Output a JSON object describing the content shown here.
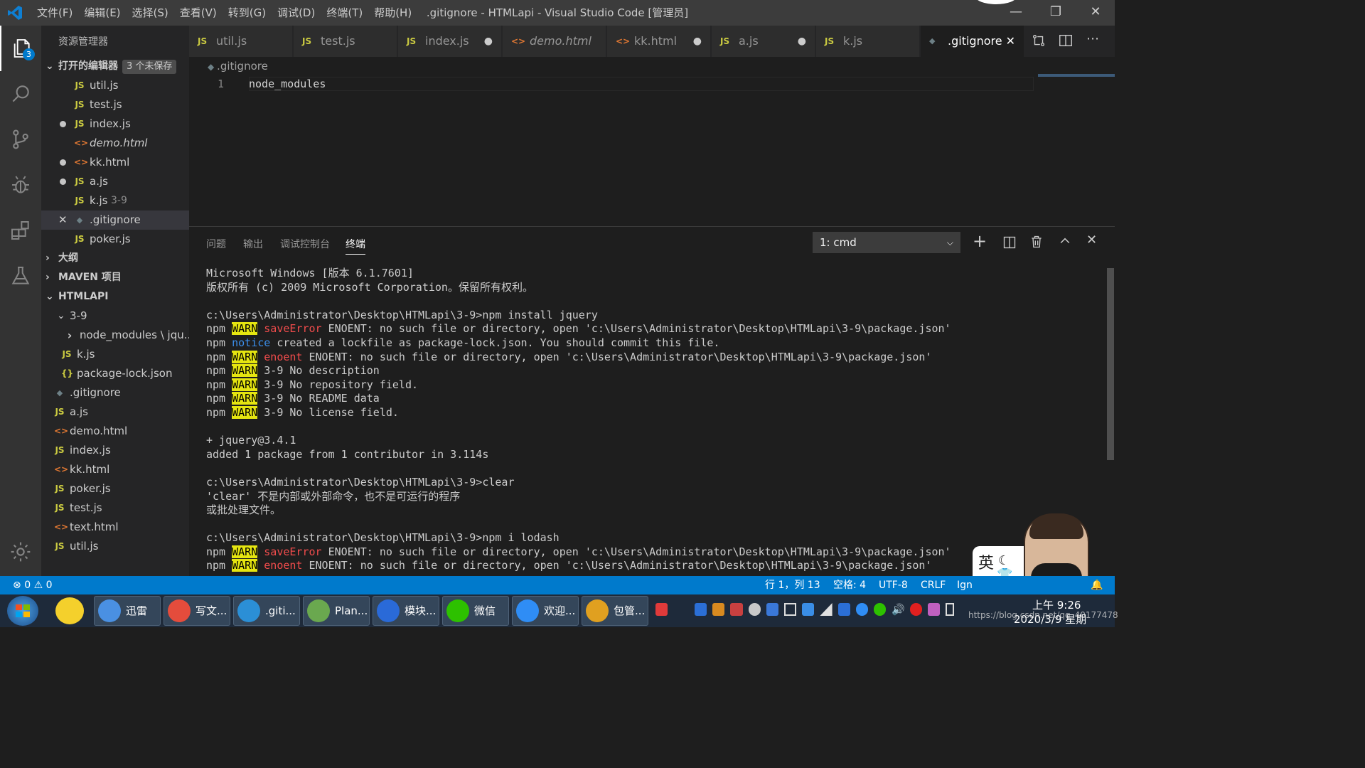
{
  "app": {
    "menu": [
      "文件(F)",
      "编辑(E)",
      "选择(S)",
      "查看(V)",
      "转到(G)",
      "调试(D)",
      "终端(T)",
      "帮助(H)"
    ],
    "window_title": ".gitignore - HTMLapi - Visual Studio Code [管理员]",
    "window_buttons": {
      "minimize": "—",
      "maximize": "❐",
      "close": "✕"
    }
  },
  "activity": {
    "explorer_badge": "3",
    "icons": [
      "files-icon",
      "search-icon",
      "source-control-icon",
      "debug-icon",
      "extensions-icon",
      "test-flask-icon",
      "settings-gear-icon"
    ]
  },
  "sidebar": {
    "title": "资源管理器",
    "open_editors": {
      "label": "打开的编辑器",
      "badge": "3 个未保存"
    },
    "open_files": [
      {
        "icon": "JS",
        "name": "util.js",
        "dot": false,
        "close": false,
        "suffix": ""
      },
      {
        "icon": "JS",
        "name": "test.js",
        "dot": false,
        "close": false,
        "suffix": ""
      },
      {
        "icon": "JS",
        "name": "index.js",
        "dot": true,
        "close": false,
        "suffix": ""
      },
      {
        "icon": "<>",
        "name": "demo.html",
        "dot": false,
        "close": false,
        "suffix": "",
        "italic": true
      },
      {
        "icon": "<>",
        "name": "kk.html",
        "dot": true,
        "close": false,
        "suffix": ""
      },
      {
        "icon": "JS",
        "name": "a.js",
        "dot": true,
        "close": false,
        "suffix": ""
      },
      {
        "icon": "JS",
        "name": "k.js",
        "dot": false,
        "close": false,
        "suffix": "3-9"
      },
      {
        "icon": "◆",
        "name": ".gitignore",
        "dot": false,
        "close": true,
        "suffix": ""
      },
      {
        "icon": "JS",
        "name": "poker.js",
        "dot": false,
        "close": false,
        "suffix": ""
      }
    ],
    "outline": "大纲",
    "maven": "MAVEN 项目",
    "project": "HTMLAPI",
    "folder": "3-9",
    "folder_items": [
      {
        "icon": "›",
        "name": "node_modules \\ jqu..."
      },
      {
        "icon": "JS",
        "name": "k.js"
      },
      {
        "icon": "{}",
        "name": "package-lock.json"
      }
    ],
    "root_items": [
      {
        "icon": "◆",
        "name": ".gitignore"
      },
      {
        "icon": "JS",
        "name": "a.js"
      },
      {
        "icon": "<>",
        "name": "demo.html"
      },
      {
        "icon": "JS",
        "name": "index.js"
      },
      {
        "icon": "<>",
        "name": "kk.html"
      },
      {
        "icon": "JS",
        "name": "poker.js"
      },
      {
        "icon": "JS",
        "name": "test.js"
      },
      {
        "icon": "<>",
        "name": "text.html"
      },
      {
        "icon": "JS",
        "name": "util.js"
      }
    ]
  },
  "tabs": [
    {
      "icon": "JS",
      "label": "util.js",
      "state": ""
    },
    {
      "icon": "JS",
      "label": "test.js",
      "state": ""
    },
    {
      "icon": "JS",
      "label": "index.js",
      "state": "●"
    },
    {
      "icon": "<>",
      "label": "demo.html",
      "state": ""
    },
    {
      "icon": "<>",
      "label": "kk.html",
      "state": "●"
    },
    {
      "icon": "JS",
      "label": "a.js",
      "state": "●"
    },
    {
      "icon": "JS",
      "label": "k.js",
      "state": ""
    },
    {
      "icon": "◆",
      "label": ".gitignore",
      "state": "✕"
    }
  ],
  "editor": {
    "breadcrumb": ".gitignore",
    "line_number": "1",
    "line_text": "node_modules"
  },
  "panel": {
    "tabs": [
      "问题",
      "输出",
      "调试控制台",
      "终端"
    ],
    "terminal_select": "1: cmd",
    "terminal_lines": [
      [
        {
          "t": "Microsoft Windows [版本 6.1.7601]"
        }
      ],
      [
        {
          "t": "版权所有 (c) 2009 Microsoft Corporation。保留所有权利。"
        }
      ],
      [
        {
          "t": ""
        }
      ],
      [
        {
          "t": "c:\\Users\\Administrator\\Desktop\\HTMLapi\\3-9>npm install jquery"
        }
      ],
      [
        {
          "t": "npm "
        },
        {
          "t": "WARN",
          "c": "warn"
        },
        {
          "t": " "
        },
        {
          "t": "saveError",
          "c": "red"
        },
        {
          "t": " ENOENT: no such file or directory, open 'c:\\Users\\Administrator\\Desktop\\HTMLapi\\3-9\\package.json'"
        }
      ],
      [
        {
          "t": "npm "
        },
        {
          "t": "notice",
          "c": "blue"
        },
        {
          "t": " created a lockfile as package-lock.json. You should commit this file."
        }
      ],
      [
        {
          "t": "npm "
        },
        {
          "t": "WARN",
          "c": "warn"
        },
        {
          "t": " "
        },
        {
          "t": "enoent",
          "c": "red"
        },
        {
          "t": " ENOENT: no such file or directory, open 'c:\\Users\\Administrator\\Desktop\\HTMLapi\\3-9\\package.json'"
        }
      ],
      [
        {
          "t": "npm "
        },
        {
          "t": "WARN",
          "c": "warn"
        },
        {
          "t": " 3-9 No description"
        }
      ],
      [
        {
          "t": "npm "
        },
        {
          "t": "WARN",
          "c": "warn"
        },
        {
          "t": " 3-9 No repository field."
        }
      ],
      [
        {
          "t": "npm "
        },
        {
          "t": "WARN",
          "c": "warn"
        },
        {
          "t": " 3-9 No README data"
        }
      ],
      [
        {
          "t": "npm "
        },
        {
          "t": "WARN",
          "c": "warn"
        },
        {
          "t": " 3-9 No license field."
        }
      ],
      [
        {
          "t": ""
        }
      ],
      [
        {
          "t": "+ jquery@3.4.1"
        }
      ],
      [
        {
          "t": "added 1 package from 1 contributor in 3.114s"
        }
      ],
      [
        {
          "t": ""
        }
      ],
      [
        {
          "t": "c:\\Users\\Administrator\\Desktop\\HTMLapi\\3-9>clear"
        }
      ],
      [
        {
          "t": "'clear' 不是内部或外部命令，也不是可运行的程序"
        }
      ],
      [
        {
          "t": "或批处理文件。"
        }
      ],
      [
        {
          "t": ""
        }
      ],
      [
        {
          "t": "c:\\Users\\Administrator\\Desktop\\HTMLapi\\3-9>npm i lodash"
        }
      ],
      [
        {
          "t": "npm "
        },
        {
          "t": "WARN",
          "c": "warn"
        },
        {
          "t": " "
        },
        {
          "t": "saveError",
          "c": "red"
        },
        {
          "t": " ENOENT: no such file or directory, open 'c:\\Users\\Administrator\\Desktop\\HTMLapi\\3-9\\package.json'"
        }
      ],
      [
        {
          "t": "npm "
        },
        {
          "t": "WARN",
          "c": "warn"
        },
        {
          "t": " "
        },
        {
          "t": "enoent",
          "c": "red"
        },
        {
          "t": " ENOENT: no such file or directory, open 'c:\\Users\\Administrator\\Desktop\\HTMLapi\\3-9\\package.json'"
        }
      ]
    ]
  },
  "statusbar": {
    "errors": "0",
    "warnings": "0",
    "position": "行 1，列 13",
    "spaces": "空格: 4",
    "encoding": "UTF-8",
    "eol": "CRLF",
    "lang": "Ign"
  },
  "ime": {
    "mode": "英",
    "punct": "，"
  },
  "taskbar": {
    "apps": [
      {
        "label": "迅雷",
        "color": "#4a90e2"
      },
      {
        "label": "写文...",
        "color": "#e44c3c"
      },
      {
        "label": ".giti...",
        "color": "#2b8fd6"
      },
      {
        "label": "Plan...",
        "color": "#6aa84f"
      },
      {
        "label": "模块...",
        "color": "#2a6ad8"
      },
      {
        "label": "微信",
        "color": "#2dc100"
      },
      {
        "label": "欢迎...",
        "color": "#2f8df5"
      },
      {
        "label": "包管...",
        "color": "#e0a020"
      }
    ],
    "time": "上午 9:26",
    "date": "2020/3/9 星期",
    "url_overlay": "https://blog.csdn.net/qq_40177478"
  },
  "colors": {
    "accent": "#007acc",
    "warn_bg": "#e5e510",
    "js": "#cbcb41",
    "html": "#e37933"
  }
}
